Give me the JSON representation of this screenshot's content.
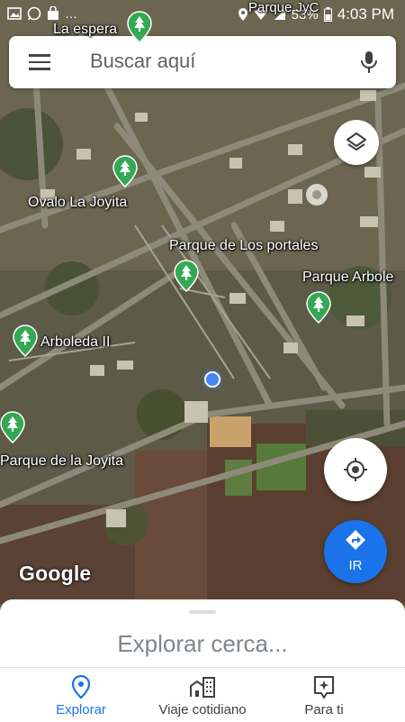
{
  "status_bar": {
    "battery": "53%",
    "time": "4:03 PM",
    "overlay_label": "Parque JyC"
  },
  "search": {
    "placeholder": "Buscar aquí"
  },
  "map_labels": {
    "la_espera": "La espera",
    "ovalo": "Ovalo La Joyita",
    "portales": "Parque de Los portales",
    "arboleda_parque": "Parque Arbole",
    "arboleda_ii": "Arboleda II",
    "joyita": "Parque de la Joyita"
  },
  "attribution": "Google",
  "directions": {
    "label": "IR"
  },
  "sheet": {
    "title": "Explorar cerca..."
  },
  "bottom_nav": [
    {
      "label": "Explorar",
      "icon": "location-pin-icon",
      "active": true
    },
    {
      "label": "Viaje cotidiano",
      "icon": "commute-buildings-icon",
      "active": false
    },
    {
      "label": "Para ti",
      "icon": "sparkle-card-icon",
      "active": false
    }
  ],
  "colors": {
    "accent": "#1a73e8",
    "park_pin": "#34a853",
    "user_dot": "#4285f4"
  }
}
